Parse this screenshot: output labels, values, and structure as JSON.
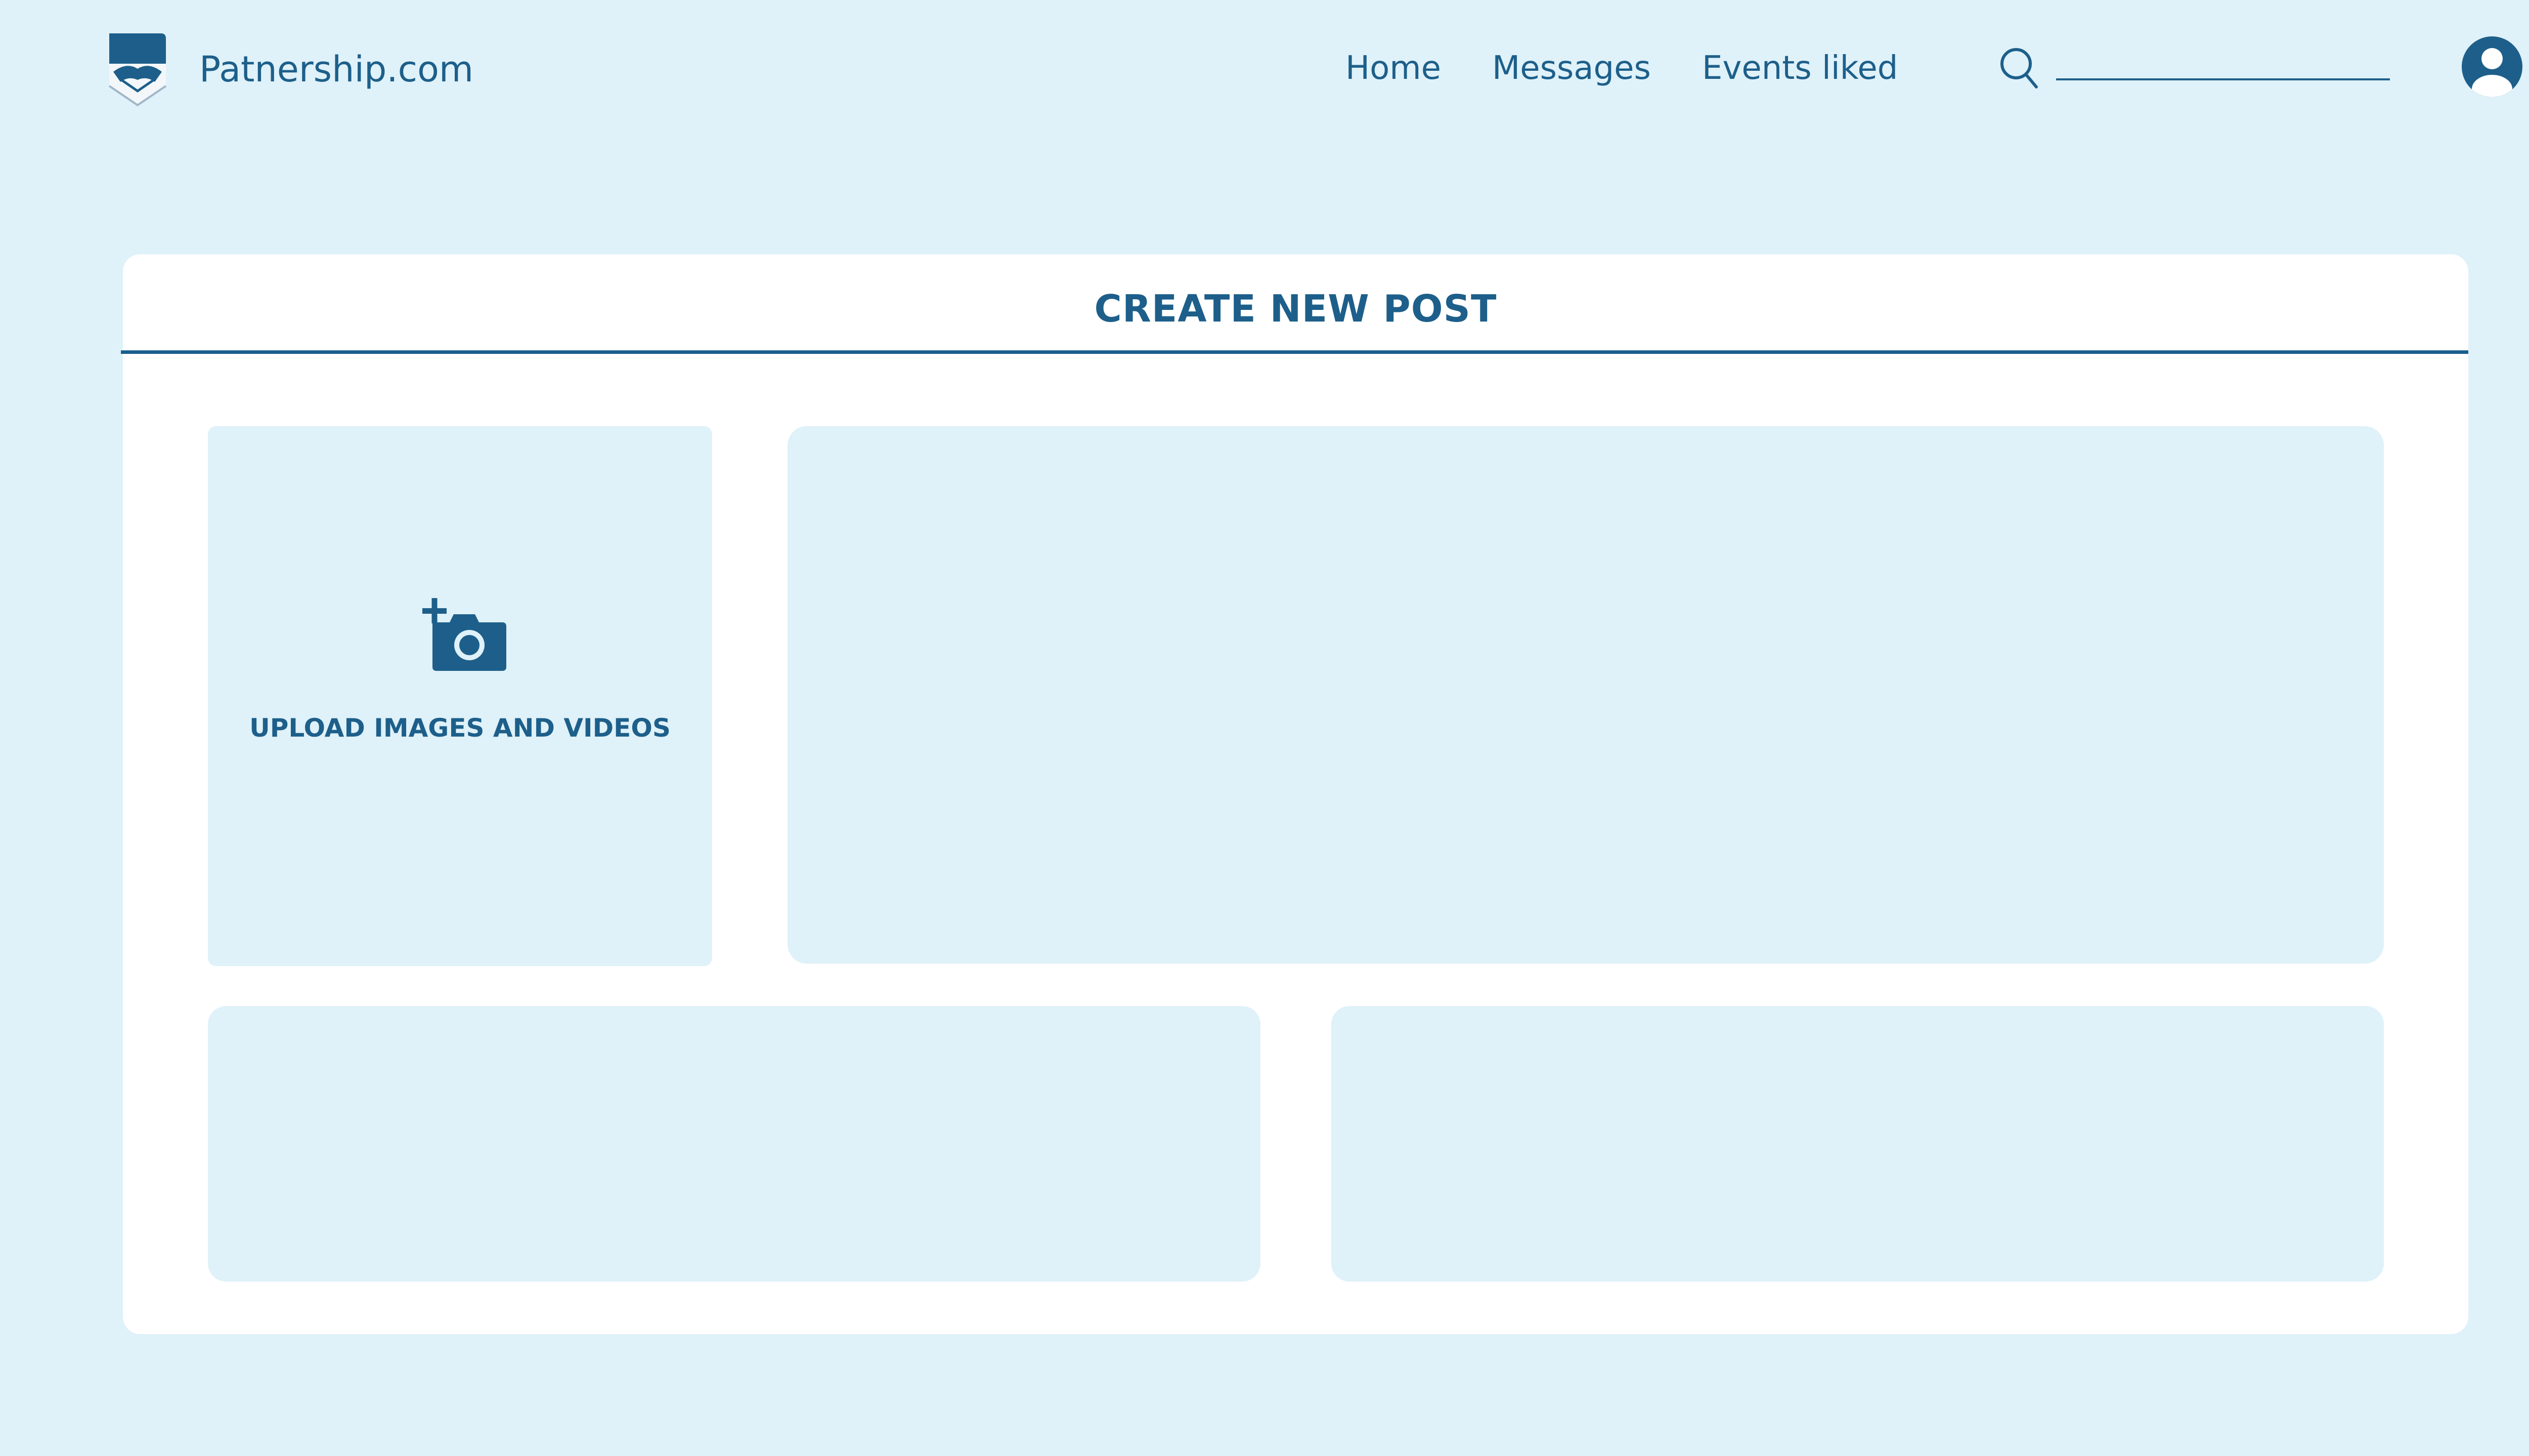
{
  "header": {
    "brand_name": "Patnership.com",
    "nav": {
      "home": "Home",
      "messages": "Messages",
      "events_liked": "Events liked"
    },
    "search": {
      "value": "",
      "placeholder": ""
    }
  },
  "create_post": {
    "title": "CREATE NEW POST",
    "upload_label": "UPLOAD IMAGES AND VIDEOS"
  },
  "icons": {
    "logo": "handshake-shield-logo",
    "search": "search-icon",
    "avatar": "user-avatar-icon",
    "upload": "camera-plus-icon"
  },
  "colors": {
    "background": "#dff1f9",
    "primary": "#1d5f8a",
    "card": "#ffffff"
  }
}
